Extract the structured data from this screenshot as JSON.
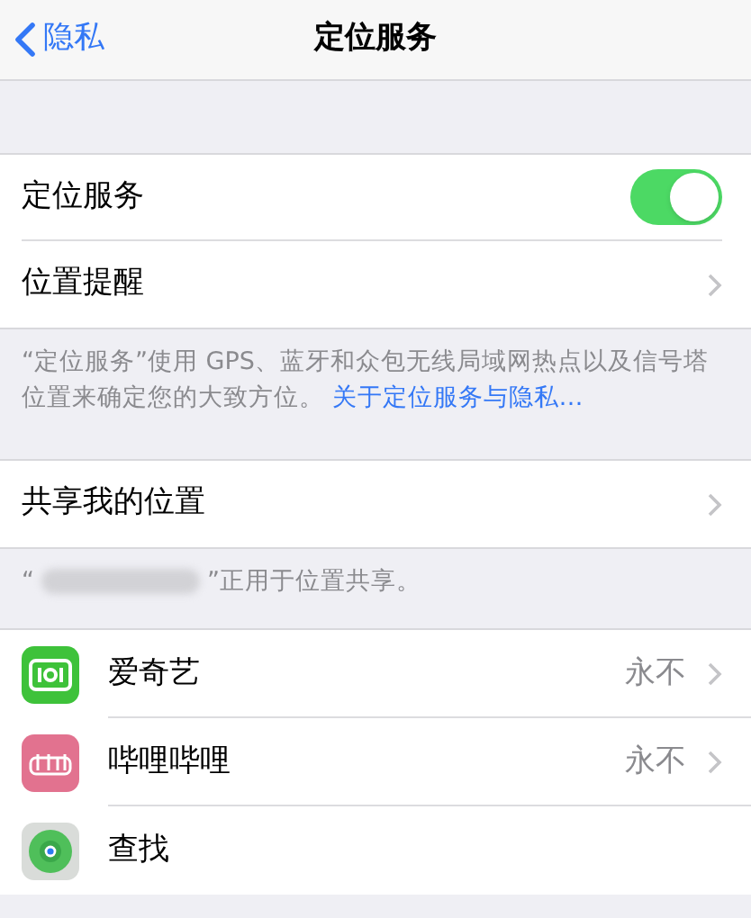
{
  "nav": {
    "back": "隐私",
    "title": "定位服务"
  },
  "section1": {
    "rows": [
      {
        "kind": "toggle",
        "label": "定位服务",
        "on": true
      },
      {
        "kind": "link",
        "label": "位置提醒"
      }
    ],
    "footer": {
      "text": "“定位服务”使用 GPS、蓝牙和众包无线局域网热点以及信号塔位置来确定您的大致方位。",
      "link": "关于定位服务与隐私…"
    }
  },
  "section2": {
    "rows": [
      {
        "kind": "link",
        "label": "共享我的位置"
      }
    ],
    "footer": {
      "before": "“",
      "after": "”正用于位置共享。"
    }
  },
  "apps": [
    {
      "kind": "video",
      "name": "爱奇艺",
      "value": "永不"
    },
    {
      "kind": "tv",
      "name": "哔哩哔哩",
      "value": "永不"
    },
    {
      "kind": "locator",
      "name": "查找"
    }
  ]
}
